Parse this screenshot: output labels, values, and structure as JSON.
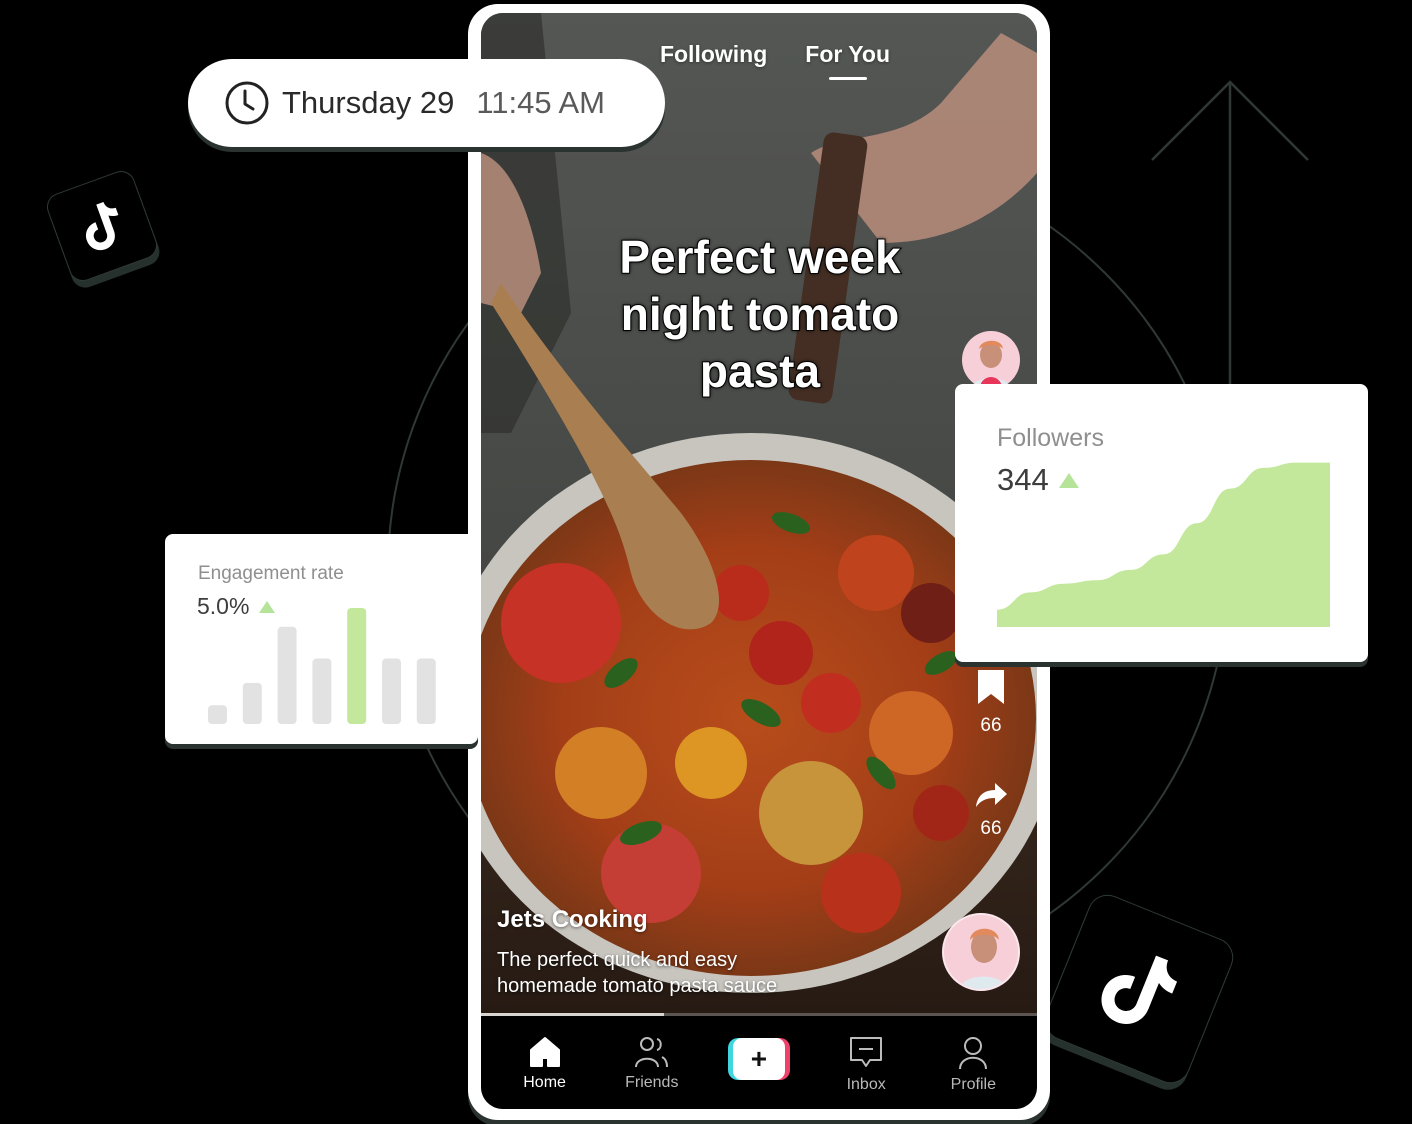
{
  "datetime": {
    "icon": "clock-icon",
    "date": "Thursday 29",
    "time": "11:45 AM"
  },
  "feed_tabs": [
    {
      "label": "Following",
      "active": false
    },
    {
      "label": "For You",
      "active": true
    }
  ],
  "video": {
    "title_lines": [
      "Perfect week",
      "night tomato",
      "pasta"
    ],
    "creator_name": "Jets Cooking",
    "caption_lines": [
      "The perfect quick and easy",
      "homemade tomato pasta sauce"
    ],
    "progress": 0.33,
    "follow_icon": "plus-icon"
  },
  "side_actions": [
    {
      "icon": "bookmark-icon",
      "count": "66"
    },
    {
      "icon": "share-icon",
      "count": "66"
    }
  ],
  "bottom_nav": [
    {
      "label": "Home",
      "icon": "home-icon",
      "active": true
    },
    {
      "label": "Friends",
      "icon": "friends-icon",
      "active": false
    },
    {
      "label": "",
      "icon": "create-plus-icon",
      "active": false
    },
    {
      "label": "Inbox",
      "icon": "inbox-icon",
      "active": false
    },
    {
      "label": "Profile",
      "icon": "profile-icon",
      "active": false
    }
  ],
  "create_button": {
    "symbol": "+"
  },
  "engagement_card": {
    "label": "Engagement rate",
    "value": "5.0%",
    "trend": "up",
    "trend_color": "#b6e39a"
  },
  "followers_card": {
    "label": "Followers",
    "value": "344",
    "trend": "up",
    "trend_color": "#b6e39a"
  },
  "colors": {
    "accent_green": "#c3e89c",
    "bar_gray": "#e2e2e2",
    "tiktok_cyan": "#3fd6e0",
    "tiktok_pink": "#f0416c"
  },
  "chart_data": [
    {
      "type": "bar",
      "title": "Engagement rate",
      "categories": [
        "1",
        "2",
        "3",
        "4",
        "5",
        "6",
        "7"
      ],
      "values": [
        1,
        2.2,
        5.2,
        3.5,
        6.2,
        3.5,
        3.5
      ],
      "highlight_index": 4,
      "xlabel": "",
      "ylabel": "",
      "ylim": [
        0,
        6.2
      ]
    },
    {
      "type": "area",
      "title": "Followers",
      "x": [
        0,
        1,
        2,
        3,
        4,
        5,
        6,
        7,
        8,
        9,
        10
      ],
      "values": [
        10,
        20,
        25,
        27,
        33,
        42,
        60,
        80,
        92,
        95,
        95
      ],
      "xlabel": "",
      "ylabel": "",
      "ylim": [
        0,
        100
      ]
    }
  ]
}
